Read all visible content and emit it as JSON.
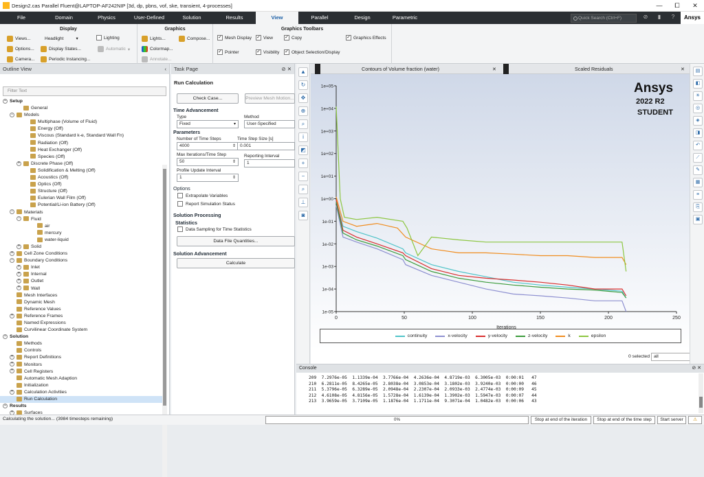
{
  "titlebar": {
    "title": "Design2.cas Parallel Fluent@LAPTOP-AF242NIP  [3d, dp, pbns, vof, ske, transient, 4-processes]",
    "minimize": "—",
    "maximize": "⧠",
    "close": "✕"
  },
  "menu": {
    "tabs": [
      "File",
      "Domain",
      "Physics",
      "User-Defined",
      "Solution",
      "Results",
      "View",
      "Parallel",
      "Design",
      "Parametric"
    ],
    "active": "View",
    "search_placeholder": "Quick Search (Ctrl+F)",
    "brand": "Ansys"
  },
  "ribbon": {
    "display": {
      "title": "Display",
      "views": "Views...",
      "headlight": "Headlight",
      "lighting": "Lighting",
      "options": "Options...",
      "display_states": "Display States...",
      "automatic": "Automatic",
      "camera": "Camera...",
      "periodic": "Periodic Instancing..."
    },
    "graphics": {
      "title": "Graphics",
      "lights": "Lights...",
      "compose": "Compose...",
      "colormap": "Colormap...",
      "annotate": "Annotate..."
    },
    "toolbars": {
      "title": "Graphics Toolbars",
      "mesh_display": "Mesh Display",
      "view": "View",
      "copy": "Copy",
      "graphics_effects": "Graphics Effects",
      "pointer": "Pointer",
      "visibility": "Visibility",
      "object_selection": "Object Selection/Display"
    }
  },
  "outline": {
    "title": "Outline View",
    "filter_placeholder": "Filter Text",
    "items": [
      {
        "label": "Setup",
        "level": 0,
        "exp": "−",
        "bold": true
      },
      {
        "label": "General",
        "level": 2,
        "icon": true
      },
      {
        "label": "Models",
        "level": 1,
        "exp": "−",
        "icon": true
      },
      {
        "label": "Multiphase (Volume of Fluid)",
        "level": 3,
        "icon": true
      },
      {
        "label": "Energy (Off)",
        "level": 3,
        "icon": true
      },
      {
        "label": "Viscous (Standard k-e, Standard Wall Fn)",
        "level": 3,
        "icon": true
      },
      {
        "label": "Radiation (Off)",
        "level": 3,
        "icon": true
      },
      {
        "label": "Heat Exchanger (Off)",
        "level": 3,
        "icon": true
      },
      {
        "label": "Species (Off)",
        "level": 3,
        "icon": true
      },
      {
        "label": "Discrete Phase (Off)",
        "level": 2,
        "exp": "+",
        "icon": true
      },
      {
        "label": "Solidification & Melting (Off)",
        "level": 3,
        "icon": true
      },
      {
        "label": "Acoustics (Off)",
        "level": 3,
        "icon": true
      },
      {
        "label": "Optics (Off)",
        "level": 3,
        "icon": true
      },
      {
        "label": "Structure (Off)",
        "level": 3,
        "icon": true
      },
      {
        "label": "Eulerian Wall Film (Off)",
        "level": 3,
        "icon": true
      },
      {
        "label": "Potential/Li-ion Battery (Off)",
        "level": 3,
        "icon": true
      },
      {
        "label": "Materials",
        "level": 1,
        "exp": "−",
        "icon": true
      },
      {
        "label": "Fluid",
        "level": 2,
        "exp": "−",
        "icon": true
      },
      {
        "label": "air",
        "level": 4,
        "icon": true
      },
      {
        "label": "mercury",
        "level": 4,
        "icon": true
      },
      {
        "label": "water-liquid",
        "level": 4,
        "icon": true
      },
      {
        "label": "Solid",
        "level": 2,
        "exp": "+",
        "icon": true
      },
      {
        "label": "Cell Zone Conditions",
        "level": 1,
        "exp": "+",
        "icon": true
      },
      {
        "label": "Boundary Conditions",
        "level": 1,
        "exp": "−",
        "icon": true
      },
      {
        "label": "Inlet",
        "level": 2,
        "exp": "+",
        "icon": true
      },
      {
        "label": "Internal",
        "level": 2,
        "exp": "+",
        "icon": true
      },
      {
        "label": "Outlet",
        "level": 2,
        "exp": "+",
        "icon": true
      },
      {
        "label": "Wall",
        "level": 2,
        "exp": "+",
        "icon": true
      },
      {
        "label": "Mesh Interfaces",
        "level": 1,
        "icon": true
      },
      {
        "label": "Dynamic Mesh",
        "level": 1,
        "icon": true
      },
      {
        "label": "Reference Values",
        "level": 1,
        "icon": true
      },
      {
        "label": "Reference Frames",
        "level": 1,
        "exp": "+",
        "icon": true
      },
      {
        "label": "Named Expressions",
        "level": 1,
        "icon": true
      },
      {
        "label": "Curvilinear Coordinate System",
        "level": 1,
        "icon": true
      },
      {
        "label": "Solution",
        "level": 0,
        "exp": "−",
        "bold": true
      },
      {
        "label": "Methods",
        "level": 1,
        "icon": true
      },
      {
        "label": "Controls",
        "level": 1,
        "icon": true
      },
      {
        "label": "Report Definitions",
        "level": 1,
        "exp": "+",
        "icon": true
      },
      {
        "label": "Monitors",
        "level": 1,
        "exp": "+",
        "icon": true
      },
      {
        "label": "Cell Registers",
        "level": 1,
        "exp": "+",
        "icon": true
      },
      {
        "label": "Automatic Mesh Adaption",
        "level": 1,
        "icon": true
      },
      {
        "label": "Initialization",
        "level": 1,
        "icon": true
      },
      {
        "label": "Calculation Activities",
        "level": 1,
        "exp": "+",
        "icon": true
      },
      {
        "label": "Run Calculation",
        "level": 1,
        "icon": true,
        "sel": true
      },
      {
        "label": "Results",
        "level": 0,
        "exp": "−",
        "bold": true
      },
      {
        "label": "Surfaces",
        "level": 1,
        "exp": "+",
        "icon": true
      }
    ]
  },
  "task": {
    "header": "Task Page",
    "title": "Run Calculation",
    "check_case": "Check Case...",
    "preview_mesh": "Preview Mesh Motion...",
    "time_adv": "Time Advancement",
    "type_label": "Type",
    "type_value": "Fixed",
    "method_label": "Method",
    "method_value": "User-Specified",
    "parameters": "Parameters",
    "nts_label": "Number of Time Steps",
    "nts_value": "4000",
    "tss_label": "Time Step Size [s]",
    "tss_value": "0.001",
    "mit_label": "Max Iterations/Time Step",
    "mit_value": "50",
    "ri_label": "Reporting Interval",
    "ri_value": "1",
    "pui_label": "Profile Update Interval",
    "pui_value": "1",
    "options": "Options",
    "extrapolate": "Extrapolate Variables",
    "report_sim": "Report Simulation Status",
    "sol_proc": "Solution Processing",
    "statistics": "Statistics",
    "data_sampling": "Data Sampling for Time Statistics",
    "data_file": "Data File Quantities...",
    "sol_adv": "Solution Advancement",
    "calculate": "Calculate"
  },
  "graphics": {
    "tab1": "Contours of Volume fraction (water)",
    "tab2": "Scaled Residuals",
    "ansys": "Ansys",
    "version": "2022 R2",
    "student": "STUDENT",
    "selected": "0 selected",
    "selected_filter": "all"
  },
  "chart_data": {
    "type": "line",
    "xlabel": "Iterations",
    "xlim": [
      0,
      250
    ],
    "xticks": [
      0,
      50,
      100,
      150,
      200,
      250
    ],
    "yscale": "log",
    "ylim": [
      1e-05,
      100000.0
    ],
    "yticks": [
      "1e-05",
      "1e-04",
      "1e-03",
      "1e-02",
      "1e-01",
      "1e+00",
      "1e+01",
      "1e+02",
      "1e+03",
      "1e+04",
      "1e+05"
    ],
    "legend_position": "bottom",
    "series": [
      {
        "name": "continuity",
        "color": "#4fc3c8",
        "points": [
          [
            0,
            0.8
          ],
          [
            5,
            0.06
          ],
          [
            15,
            0.035
          ],
          [
            30,
            0.018
          ],
          [
            49,
            0.006
          ],
          [
            51,
            0.004
          ],
          [
            70,
            0.0012
          ],
          [
            90,
            0.0006
          ],
          [
            110,
            0.00035
          ],
          [
            130,
            0.0002
          ],
          [
            150,
            0.00015
          ],
          [
            170,
            0.00012
          ],
          [
            190,
            0.0001
          ],
          [
            210,
            8e-05
          ],
          [
            213,
            4e-05
          ]
        ]
      },
      {
        "name": "x-velocity",
        "color": "#8d8fd0",
        "points": [
          [
            0,
            0.5
          ],
          [
            5,
            0.02
          ],
          [
            15,
            0.012
          ],
          [
            30,
            0.006
          ],
          [
            49,
            0.002
          ],
          [
            51,
            0.0012
          ],
          [
            70,
            0.0004
          ],
          [
            90,
            0.0002
          ],
          [
            110,
            0.0001
          ],
          [
            130,
            6e-05
          ],
          [
            150,
            5e-05
          ],
          [
            170,
            4e-05
          ],
          [
            190,
            3e-05
          ],
          [
            210,
            3e-05
          ],
          [
            213,
            1e-05
          ]
        ]
      },
      {
        "name": "y-velocity",
        "color": "#d92d2d",
        "points": [
          [
            0,
            0.9
          ],
          [
            5,
            0.04
          ],
          [
            15,
            0.02
          ],
          [
            30,
            0.01
          ],
          [
            49,
            0.004
          ],
          [
            51,
            0.003
          ],
          [
            70,
            0.0008
          ],
          [
            90,
            0.0004
          ],
          [
            110,
            0.0003
          ],
          [
            130,
            0.00025
          ],
          [
            150,
            0.0002
          ],
          [
            170,
            0.00015
          ],
          [
            190,
            0.0001
          ],
          [
            210,
            0.0001
          ],
          [
            213,
            5e-05
          ]
        ]
      },
      {
        "name": "z-velocity",
        "color": "#3b9b3b",
        "points": [
          [
            0,
            0.7
          ],
          [
            5,
            0.03
          ],
          [
            15,
            0.015
          ],
          [
            30,
            0.008
          ],
          [
            49,
            0.003
          ],
          [
            51,
            0.002
          ],
          [
            70,
            0.0006
          ],
          [
            90,
            0.0003
          ],
          [
            110,
            0.0002
          ],
          [
            130,
            0.00015
          ],
          [
            150,
            0.00012
          ],
          [
            170,
            0.0001
          ],
          [
            190,
            9e-05
          ],
          [
            210,
            7e-05
          ],
          [
            213,
            4e-05
          ]
        ]
      },
      {
        "name": "k",
        "color": "#f08c1e",
        "points": [
          [
            0,
            1.2
          ],
          [
            5,
            0.1
          ],
          [
            15,
            0.06
          ],
          [
            30,
            0.08
          ],
          [
            45,
            0.05
          ],
          [
            51,
            0.02
          ],
          [
            70,
            0.006
          ],
          [
            90,
            0.004
          ],
          [
            110,
            0.004
          ],
          [
            130,
            0.0035
          ],
          [
            150,
            0.003
          ],
          [
            170,
            0.003
          ],
          [
            190,
            0.0025
          ],
          [
            210,
            0.0025
          ],
          [
            213,
            0.0012
          ]
        ]
      },
      {
        "name": "epsilon",
        "color": "#8cc63f",
        "points": [
          [
            0,
            12000
          ],
          [
            3,
            1
          ],
          [
            6,
            0.15
          ],
          [
            15,
            0.12
          ],
          [
            30,
            0.15
          ],
          [
            49,
            0.1
          ],
          [
            52,
            0.05
          ],
          [
            60,
            0.003
          ],
          [
            70,
            0.02
          ],
          [
            90,
            0.015
          ],
          [
            110,
            0.012
          ],
          [
            130,
            0.012
          ],
          [
            150,
            0.012
          ],
          [
            170,
            0.012
          ],
          [
            190,
            0.012
          ],
          [
            210,
            0.012
          ],
          [
            213,
            0.0006
          ]
        ]
      }
    ]
  },
  "console": {
    "title": "Console",
    "rows": [
      "209  7.2976e-05  1.1339e-04  3.7766e-04  4.2636e-04  4.8719e-03  6.3005e-03  0:00:01   47",
      "210  6.2811e-05  8.4265e-05  2.8038e-04  3.0853e-04  3.1802e-03  3.9240e-03  0:00:00   46",
      "211  5.3796e-05  6.3289e-05  2.0948e-04  2.2307e-04  2.0933e-03  2.4774e-03  0:00:09   45",
      "212  4.6108e-05  4.8156e-05  1.5728e-04  1.6139e-04  1.3902e-03  1.5947e-03  0:00:07   44",
      "213  3.9659e-05  3.7109e-05  1.1876e-04  1.1711e-04  9.3071e-04  1.0482e-03  0:00:06   43"
    ]
  },
  "status": {
    "text": "Calculating the solution... (3984 timesteps remaining)",
    "progress": "0%",
    "progress_value": 0,
    "stop_iter": "Stop at end of the iteration",
    "stop_step": "Stop at end of the time step",
    "start_server": "Start server"
  }
}
